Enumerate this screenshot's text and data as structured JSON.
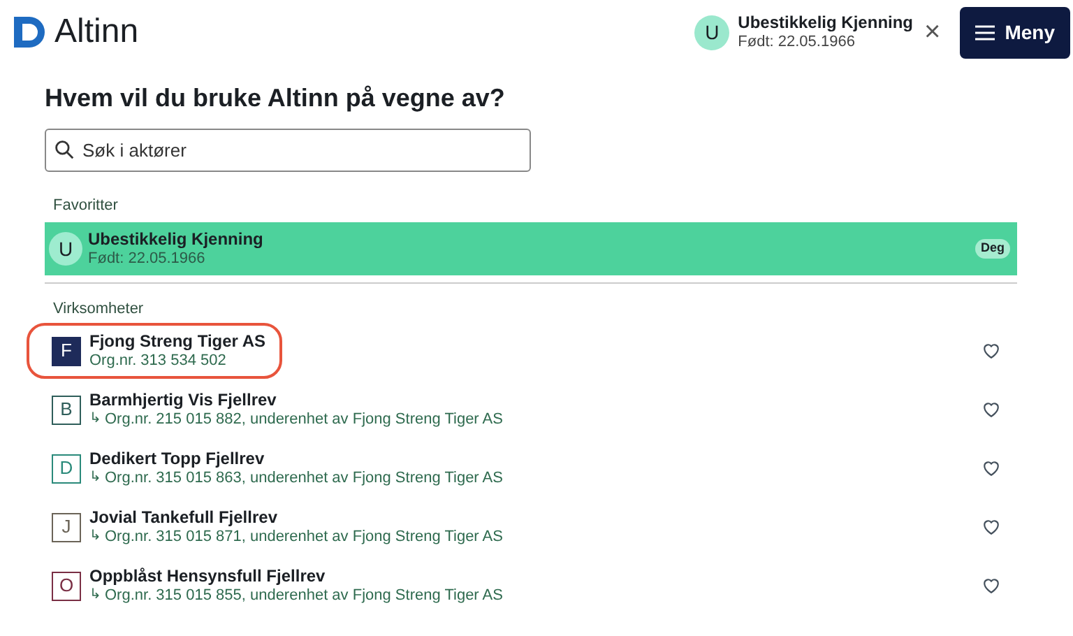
{
  "header": {
    "logo": "Altinn",
    "user": {
      "initial": "U",
      "name": "Ubestikkelig Kjenning",
      "subtitle": "Født: 22.05.1966"
    },
    "close": "×",
    "menu": "Meny"
  },
  "heading": "Hvem vil du bruke Altinn på vegne av?",
  "search": {
    "placeholder": "Søk i aktører"
  },
  "favorites": {
    "label": "Favoritter",
    "items": [
      {
        "initial": "U",
        "name": "Ubestikkelig Kjenning",
        "subtitle": "Født: 22.05.1966",
        "badge": "Deg"
      }
    ]
  },
  "companies": {
    "label": "Virksomheter",
    "items": [
      {
        "kind": "main",
        "initial": "F",
        "name": "Fjong Streng Tiger AS",
        "subtitle": "Org.nr. 313 534 502",
        "color": "#1e2b5a",
        "highlighted": true
      },
      {
        "kind": "sub",
        "initial": "B",
        "name": "Barmhjertig Vis Fjellrev",
        "arrow": "↳",
        "subtitle": "Org.nr. 215 015 882, underenhet av Fjong Streng Tiger AS",
        "color": "#2f5e5a",
        "highlighted": false
      },
      {
        "kind": "sub",
        "initial": "D",
        "name": "Dedikert Topp Fjellrev",
        "arrow": "↳",
        "subtitle": "Org.nr. 315 015 863, underenhet av Fjong Streng Tiger AS",
        "color": "#2a8a7a",
        "highlighted": false
      },
      {
        "kind": "sub",
        "initial": "J",
        "name": "Jovial Tankefull Fjellrev",
        "arrow": "↳",
        "subtitle": "Org.nr. 315 015 871, underenhet av Fjong Streng Tiger AS",
        "color": "#6b6458",
        "highlighted": false
      },
      {
        "kind": "sub",
        "initial": "O",
        "name": "Oppblåst Hensynsfull Fjellrev",
        "arrow": "↳",
        "subtitle": "Org.nr. 315 015 855, underenhet av Fjong Streng Tiger AS",
        "color": "#7a2f45",
        "highlighted": false
      }
    ]
  }
}
